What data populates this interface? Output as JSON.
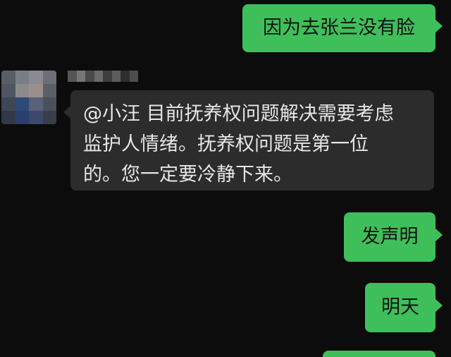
{
  "messages": [
    {
      "id": "m1",
      "direction": "outgoing",
      "text": "因为去张兰没有脸"
    },
    {
      "id": "m2",
      "direction": "incoming",
      "lines": [
        "@小汪 目前抚养权问题解决需要考虑",
        "监护人情绪。抚养权问题是第一位",
        "的。您一定要冷静下来。"
      ]
    },
    {
      "id": "m3",
      "direction": "outgoing",
      "text": "发声明"
    },
    {
      "id": "m4",
      "direction": "outgoing",
      "text": "明天"
    }
  ],
  "colors": {
    "background": "#0c0c0c",
    "outgoing_bubble": "#3fbf5a",
    "incoming_bubble": "#2c2c2c",
    "incoming_text": "#e6e6e6",
    "outgoing_text": "#111111"
  },
  "sender": {
    "avatar": "pixelated-avatar-icon",
    "name_blurred": true
  }
}
